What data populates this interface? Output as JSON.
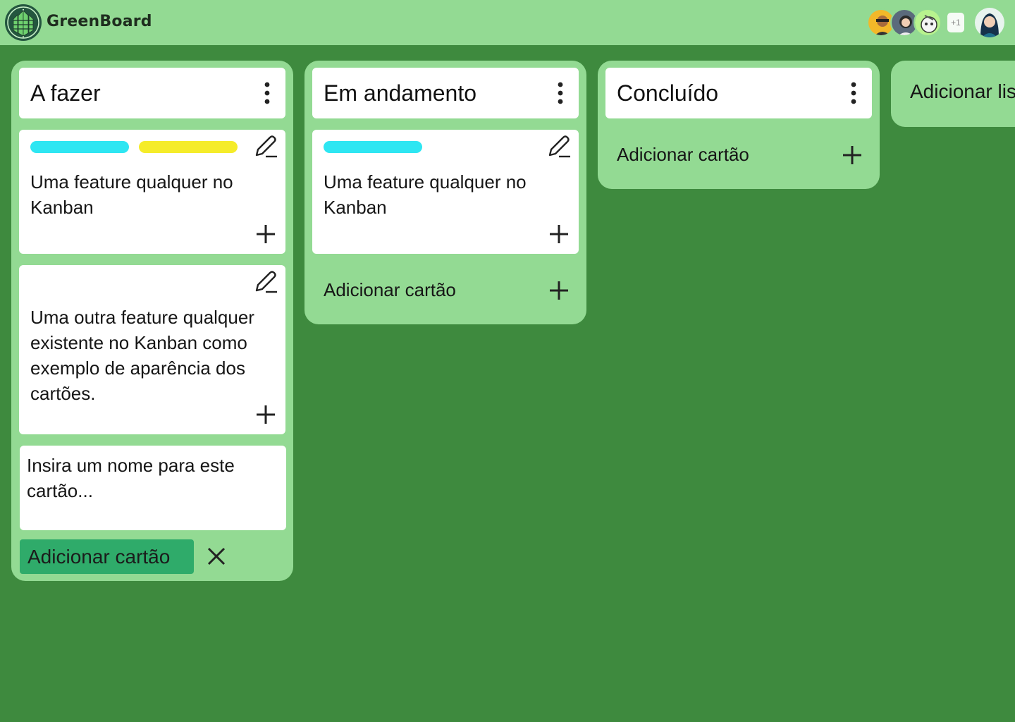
{
  "app": {
    "title": "GreenBoard",
    "logo_icon": "leaf-globe-logo-icon"
  },
  "header": {
    "members_extra": "+1",
    "member_avatars": [
      "avatar-1",
      "avatar-2",
      "avatar-3"
    ],
    "current_user_avatar": "avatar-self"
  },
  "lists": [
    {
      "title": "A fazer",
      "cards": [
        {
          "labels": [
            "#2ee6f2",
            "#f5ec2a"
          ],
          "text": "Uma feature qualquer no Kanban"
        },
        {
          "labels": [],
          "text": "Uma outra feature qualquer existente no Kanban como exemplo de aparência dos cartões."
        }
      ],
      "new_card": {
        "value": "Insira um nome para este cartão...",
        "confirm_label": "Adicionar cartão"
      }
    },
    {
      "title": "Em andamento",
      "cards": [
        {
          "labels": [
            "#2ee6f2"
          ],
          "text": "Uma feature qualquer no Kanban"
        }
      ],
      "add_card_label": "Adicionar cartão"
    },
    {
      "title": "Concluído",
      "cards": [],
      "add_card_label": "Adicionar cartão"
    }
  ],
  "add_list_label": "Adicionar lista",
  "colors": {
    "background": "#3e8a3e",
    "panel": "#93da93",
    "confirm": "#2fab6a",
    "label_cyan": "#2ee6f2",
    "label_yellow": "#f5ec2a"
  }
}
